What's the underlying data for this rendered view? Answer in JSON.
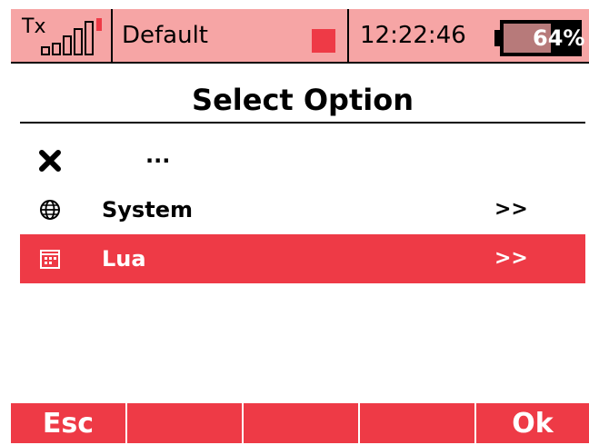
{
  "status_bar": {
    "tx_label": "Tx",
    "model_name": "Default",
    "time": "12:22:46",
    "battery_percent": "64%",
    "battery_level": 0.64,
    "signal_bars": 5
  },
  "page_title": "Select Option",
  "list_items": [
    {
      "icon": "close-icon",
      "label": "...",
      "arrow": ""
    },
    {
      "icon": "globe-icon",
      "label": "System",
      "arrow": ">>"
    },
    {
      "icon": "calendar-grid-icon",
      "label": "Lua",
      "arrow": ">>",
      "selected": true
    }
  ],
  "softkeys": [
    "Esc",
    "",
    "",
    "",
    "Ok"
  ],
  "colors": {
    "status_bg": "#f6a5a5",
    "accent_red": "#ee3a46",
    "battery_fill": "#b77a7a"
  }
}
